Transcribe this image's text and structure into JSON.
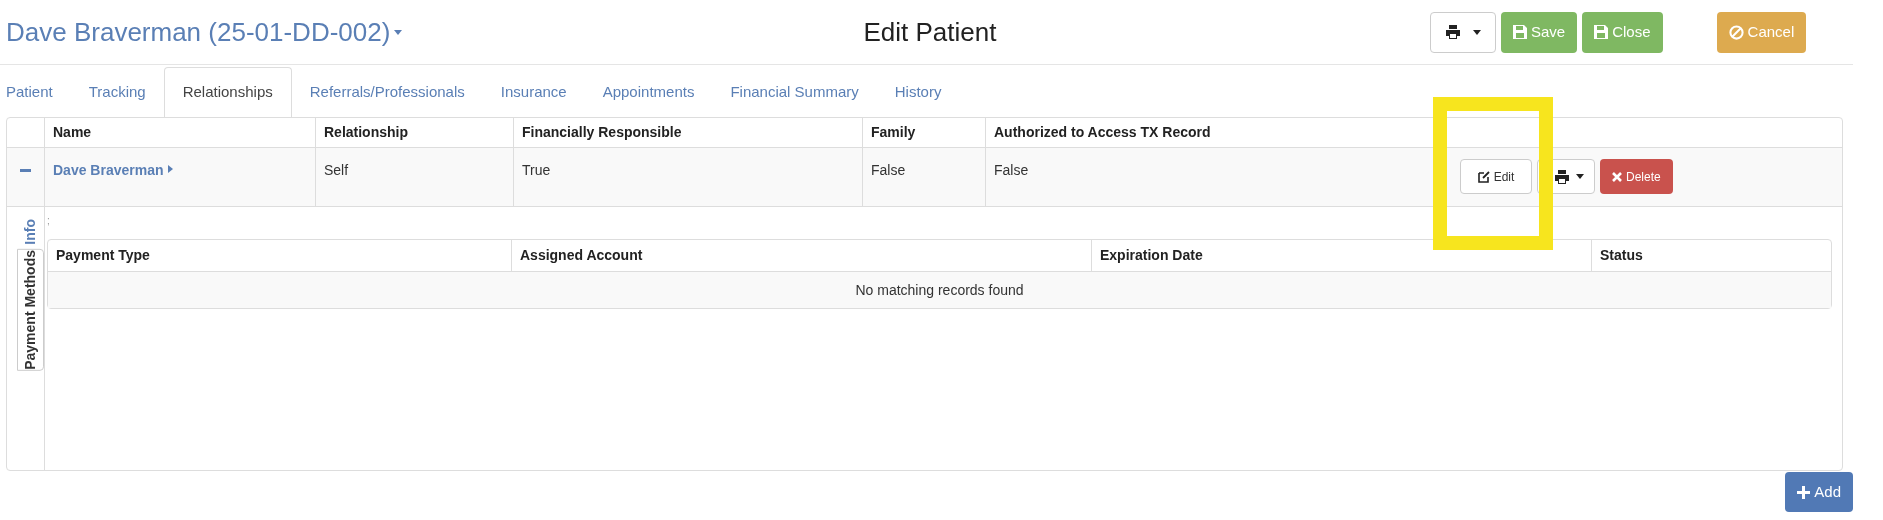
{
  "header": {
    "patient_name": "Dave Braverman (25-01-DD-002)",
    "title": "Edit Patient",
    "buttons": [
      {
        "kind": "print"
      },
      {
        "kind": "save",
        "label": "Save"
      },
      {
        "kind": "save",
        "label": "Close"
      },
      {
        "kind": "cancel",
        "label": "Cancel"
      }
    ]
  },
  "tabs": [
    {
      "label": "Patient",
      "selected": false
    },
    {
      "label": "Tracking",
      "selected": false
    },
    {
      "label": "Relationships",
      "selected": true
    },
    {
      "label": "Referrals/Professionals",
      "selected": false
    },
    {
      "label": "Insurance",
      "selected": false
    },
    {
      "label": "Appointments",
      "selected": false
    },
    {
      "label": "Financial Summary",
      "selected": false
    },
    {
      "label": "History",
      "selected": false
    }
  ],
  "relationships": {
    "columns": [
      "Name",
      "Relationship",
      "Financially Responsible",
      "Family",
      "Authorized to Access TX Record"
    ],
    "rows": [
      {
        "expanded": true,
        "name": "Dave Braverman",
        "relationship": "Self",
        "financially_responsible": "True",
        "family": "False",
        "authorized": "False",
        "actions": [
          {
            "kind": "edit",
            "label": "Edit"
          },
          {
            "kind": "print"
          },
          {
            "kind": "delete",
            "label": "Delete"
          }
        ]
      }
    ]
  },
  "detail": {
    "side_tabs": [
      {
        "label": "Info",
        "selected": false
      },
      {
        "label": "Payment Methods",
        "selected": true
      }
    ],
    "stray_mark": ";",
    "payment_methods": {
      "columns": [
        "Payment Type",
        "Assigned Account",
        "Expiration Date",
        "Status"
      ],
      "empty_message": "No matching records found"
    }
  },
  "highlight": true,
  "add_button": "Add"
}
